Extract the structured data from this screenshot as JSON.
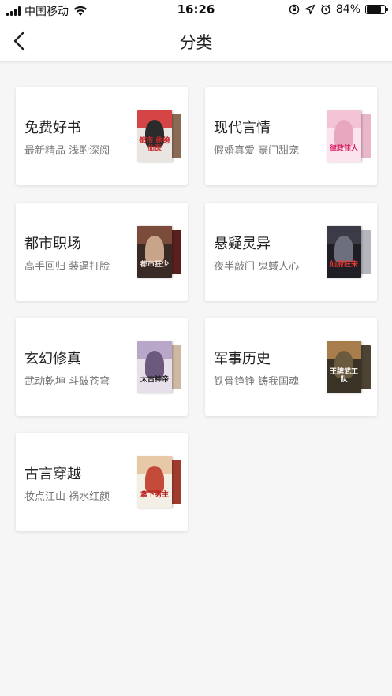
{
  "status_bar": {
    "carrier": "中国移动",
    "time": "16:26",
    "battery": "84%",
    "battery_level": 0.84
  },
  "nav": {
    "title": "分类",
    "back_icon": "chevron-left-icon"
  },
  "categories": [
    {
      "title": "免费好书",
      "subtitle": "最新精品 浅酌深阅",
      "cover": {
        "bg": "#e9e6e2",
        "band": "#d64545",
        "figure": "#2b2b2b",
        "side": "#8a6a55",
        "text": "都市\n纨绔仙医",
        "text_color": "#c62828"
      }
    },
    {
      "title": "现代言情",
      "subtitle": "假婚真爱 豪门甜宠",
      "cover": {
        "bg": "#fbe4ee",
        "band": "#f3c3d6",
        "figure": "#e9a6bf",
        "side": "#e8b7cb",
        "text": "律政佳人",
        "text_color": "#d81b60"
      }
    },
    {
      "title": "都市职场",
      "subtitle": "高手回归 装逼打脸",
      "cover": {
        "bg": "#3a2a26",
        "band": "#7b4b3b",
        "figure": "#c8a48a",
        "side": "#5a1f1f",
        "text": "都市狂少",
        "text_color": "#f4e9e0"
      }
    },
    {
      "title": "悬疑灵异",
      "subtitle": "夜半敲门 鬼蜮人心",
      "cover": {
        "bg": "#1e1e24",
        "band": "#3b3b47",
        "figure": "#6d6f7e",
        "side": "#b5b6bd",
        "text": "仙府狂宋",
        "text_color": "#e53935"
      }
    },
    {
      "title": "玄幻修真",
      "subtitle": "武动乾坤 斗破苍穹",
      "cover": {
        "bg": "#e7dfe9",
        "band": "#b9a7c9",
        "figure": "#6b5a7d",
        "side": "#cdb8a3",
        "text": "太古神帝",
        "text_color": "#1a1a1a"
      }
    },
    {
      "title": "军事历史",
      "subtitle": "铁骨铮铮 铸我国魂",
      "cover": {
        "bg": "#3b3226",
        "band": "#a97c4b",
        "figure": "#6a5a3e",
        "side": "#4d4333",
        "text": "王牌武工队",
        "text_color": "#ffffff"
      }
    },
    {
      "title": "古言穿越",
      "subtitle": "妆点江山 祸水红颜",
      "cover": {
        "bg": "#f4efe4",
        "band": "#e7c9a8",
        "figure": "#c44b3a",
        "side": "#9f3a2e",
        "text": "拿下男主",
        "text_color": "#b71c1c"
      }
    }
  ]
}
